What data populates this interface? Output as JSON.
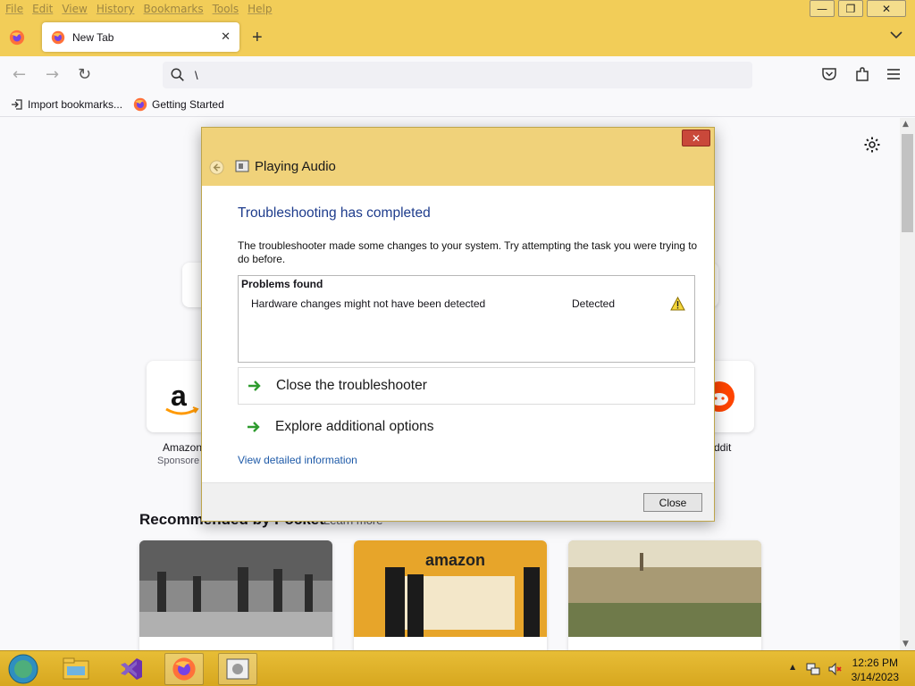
{
  "browser": {
    "menu": [
      "File",
      "Edit",
      "View",
      "History",
      "Bookmarks",
      "Tools",
      "Help"
    ],
    "window_controls": {
      "minimize": "—",
      "restore": "❐",
      "close": "✕"
    },
    "tab": {
      "label": "New Tab",
      "close": "✕"
    },
    "new_tab_symbol": "+",
    "tab_list_symbol": "⌄",
    "nav": {
      "back": "←",
      "forward": "→",
      "reload": "↻"
    },
    "urlbar": {
      "value": "\\"
    },
    "bookmarks": [
      {
        "label": "Import bookmarks...",
        "icon": "import-icon"
      },
      {
        "label": "Getting Started",
        "icon": "firefox-icon"
      }
    ]
  },
  "newtab": {
    "tiles": [
      {
        "label": "Amazon",
        "sub": "Sponsore"
      },
      {
        "label": "ddit",
        "sub": ""
      }
    ],
    "pocket": {
      "heading": "Recommended by Pocket",
      "learn_more": "Learn more"
    },
    "cards": [
      {
        "image": "black-and-white-parade-photo"
      },
      {
        "image": "amazon-office-photo"
      },
      {
        "image": "city-panorama-photo"
      }
    ]
  },
  "dialog": {
    "title": "Playing Audio",
    "heading": "Troubleshooting has completed",
    "description": "The troubleshooter made some changes to your system. Try attempting the task you were trying to do before.",
    "problems": {
      "header": "Problems found",
      "rows": [
        {
          "name": "Hardware changes might not have been detected",
          "status": "Detected",
          "icon": "warning-icon"
        }
      ]
    },
    "options": [
      {
        "label": "Close the troubleshooter",
        "icon": "green-arrow-icon"
      },
      {
        "label": "Explore additional options",
        "icon": "green-arrow-icon"
      }
    ],
    "link": "View detailed information",
    "close_button": "Close",
    "close_x": "✕"
  },
  "taskbar": {
    "apps": [
      "file-explorer-icon",
      "visual-studio-icon",
      "firefox-icon",
      "troubleshooter-icon"
    ],
    "tray": {
      "show_hidden": "▲"
    },
    "clock": {
      "time": "12:26 PM",
      "date": "3/14/2023"
    }
  },
  "colors": {
    "titlebar": "#f2cd58",
    "taskbar": "#e1b42d",
    "dialog_header": "#f0d27a",
    "link": "#1e5aa8",
    "heading": "#1e3c8c"
  }
}
